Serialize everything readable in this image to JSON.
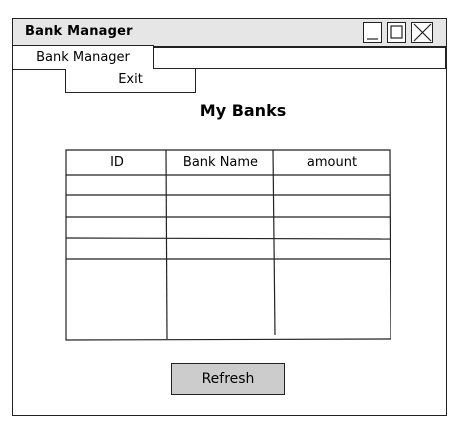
{
  "window": {
    "title": "Bank Manager",
    "controls": [
      "minimize-icon",
      "maximize-icon",
      "close-icon"
    ]
  },
  "menu": {
    "label": "Bank Manager",
    "items": [
      {
        "label": "Exit"
      }
    ]
  },
  "main": {
    "heading": "My Banks",
    "table": {
      "columns": [
        "ID",
        "Bank Name",
        "amount"
      ],
      "rows": []
    },
    "refresh_label": "Refresh"
  }
}
